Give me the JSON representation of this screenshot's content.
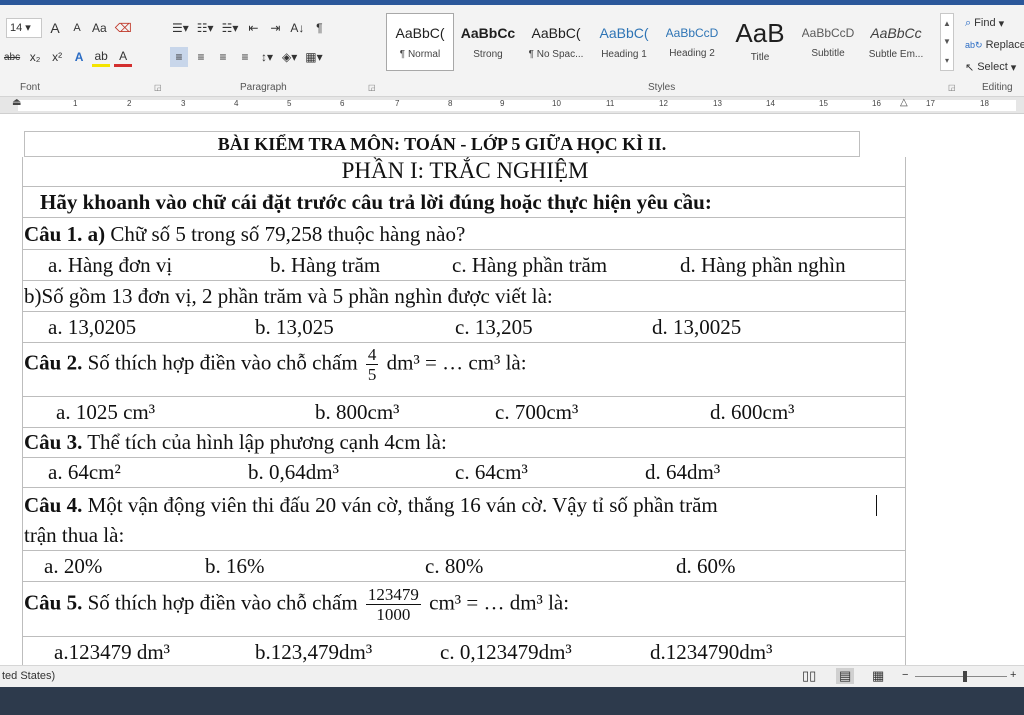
{
  "ribbon": {
    "font": {
      "size": "14",
      "grow": "A",
      "shrink": "A",
      "case": "Aa",
      "strike": "abc",
      "sub": "x₂",
      "sup": "x²",
      "text_effects": "A",
      "highlight": "ab",
      "font_color": "A",
      "label": "Font"
    },
    "paragraph": {
      "label": "Paragraph",
      "sort": "A↓",
      "pilcrow": "¶"
    },
    "styles": {
      "label": "Styles",
      "items": [
        {
          "preview": "AaBbC(",
          "name": "¶ Normal"
        },
        {
          "preview": "AaBbCc",
          "name": "Strong"
        },
        {
          "preview": "AaBbC(",
          "name": "¶ No Spac..."
        },
        {
          "preview": "AaBbC(",
          "name": "Heading 1"
        },
        {
          "preview": "AaBbCcD",
          "name": "Heading 2"
        },
        {
          "preview": "AaB",
          "name": "Title"
        },
        {
          "preview": "AaBbCcD",
          "name": "Subtitle"
        },
        {
          "preview": "AaBbCc",
          "name": "Subtle Em..."
        }
      ]
    },
    "editing": {
      "find": "Find",
      "replace": "Replace",
      "select": "Select",
      "label": "Editing"
    }
  },
  "ruler": {
    "ticks": [
      "1",
      "2",
      "3",
      "4",
      "5",
      "6",
      "7",
      "8",
      "9",
      "10",
      "11",
      "12",
      "13",
      "14",
      "15",
      "16",
      "17",
      "18"
    ]
  },
  "document": {
    "title": "BÀI KIỂM TRA MÔN: TOÁN - LỚP 5 GIỮA HỌC KÌ II.",
    "part": "PHẦN I: TRẮC NGHIỆM",
    "instruction": "Hãy khoanh vào chữ cái đặt trước câu trả lời đúng hoặc thực hiện yêu cầu:",
    "q1a": {
      "label": "Câu 1. a)",
      "text": " Chữ số 5 trong số 79,258 thuộc hàng nào?",
      "options": [
        "a. Hàng đơn vị",
        "b. Hàng trăm",
        "c. Hàng phần trăm",
        "d. Hàng phần nghìn"
      ]
    },
    "q1b": {
      "text": "b)Số gồm 13 đơn vị, 2 phần trăm và 5 phần nghìn được viết là:",
      "options": [
        "a. 13,0205",
        "b. 13,025",
        "c. 13,205",
        "d. 13,0025"
      ]
    },
    "q2": {
      "label": "Câu 2.",
      "text": " Số thích hợp điền vào chỗ chấm",
      "num": "4",
      "den": "5",
      "after": "dm³ = … cm³ là:",
      "options": [
        "a. 1025 cm³",
        "b. 800cm³",
        "c. 700cm³",
        "d. 600cm³"
      ]
    },
    "q3": {
      "label": "Câu 3.",
      "text": " Thể tích của hình lập phương cạnh 4cm là:",
      "options": [
        "a. 64cm²",
        "b. 0,64dm³",
        "c. 64cm³",
        "d. 64dm³"
      ]
    },
    "q4": {
      "label": "Câu 4.",
      "text": " Một vận động viên thi đấu 20 ván cờ, thắng 16 ván cờ. Vậy tỉ số phần trăm",
      "text2": "trận thua là:",
      "options": [
        "a. 20%",
        "b. 16%",
        "c. 80%",
        "d. 60%"
      ]
    },
    "q5": {
      "label": "Câu 5.",
      "text": " Số thích hợp điền vào chỗ chấm",
      "num": "123479",
      "den": "1000",
      "after": "cm³ = … dm³ là:",
      "options": [
        "a.123479 dm³",
        "b.123,479dm³",
        "c. 0,123479dm³",
        "d.1234790dm³"
      ]
    }
  },
  "status": {
    "left": "ted States)"
  }
}
